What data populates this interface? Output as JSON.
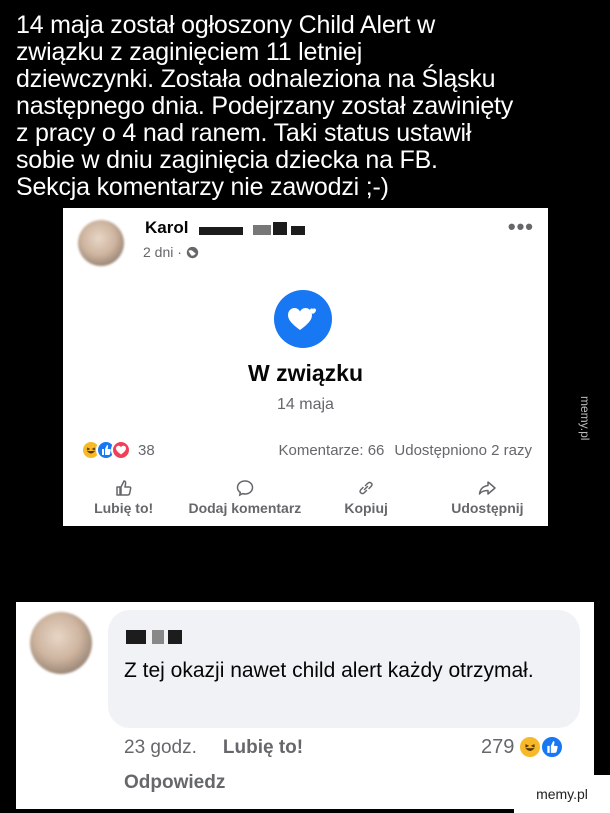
{
  "caption": "14 maja został ogłoszony Child Alert w\nzwiązku z zaginięciem 11 letniej\ndziewczynki. Została odnaleziona na Śląsku\nnastępnego dnia. Podejrzany został zawinięty\nz pracy o 4 nad ranem. Taki status ustawił\nsobie w dniu zaginięcia dziecka na FB.\nSekcja komentarzy nie zawodzi ;-)",
  "post": {
    "author": "Karol",
    "time": "2 dni ·",
    "more": "•••",
    "relationship_status": "W związku",
    "date": "14 maja",
    "reaction_count": "38",
    "comments": "Komentarze: 66",
    "shares": "Udostępniono 2 razy",
    "actions": {
      "like": "Lubię to!",
      "comment": "Dodaj komentarz",
      "copy": "Kopiuj",
      "share": "Udostępnij"
    },
    "accent_color": "#1877f2"
  },
  "comment": {
    "text": "Z tej okazji nawet child alert każdy otrzymał.",
    "time": "23 godz.",
    "like": "Lubię to!",
    "reply": "Odpowiedz",
    "reaction_count": "279"
  },
  "watermarks": {
    "side": "memy.pl",
    "corner": "memy.pl"
  }
}
